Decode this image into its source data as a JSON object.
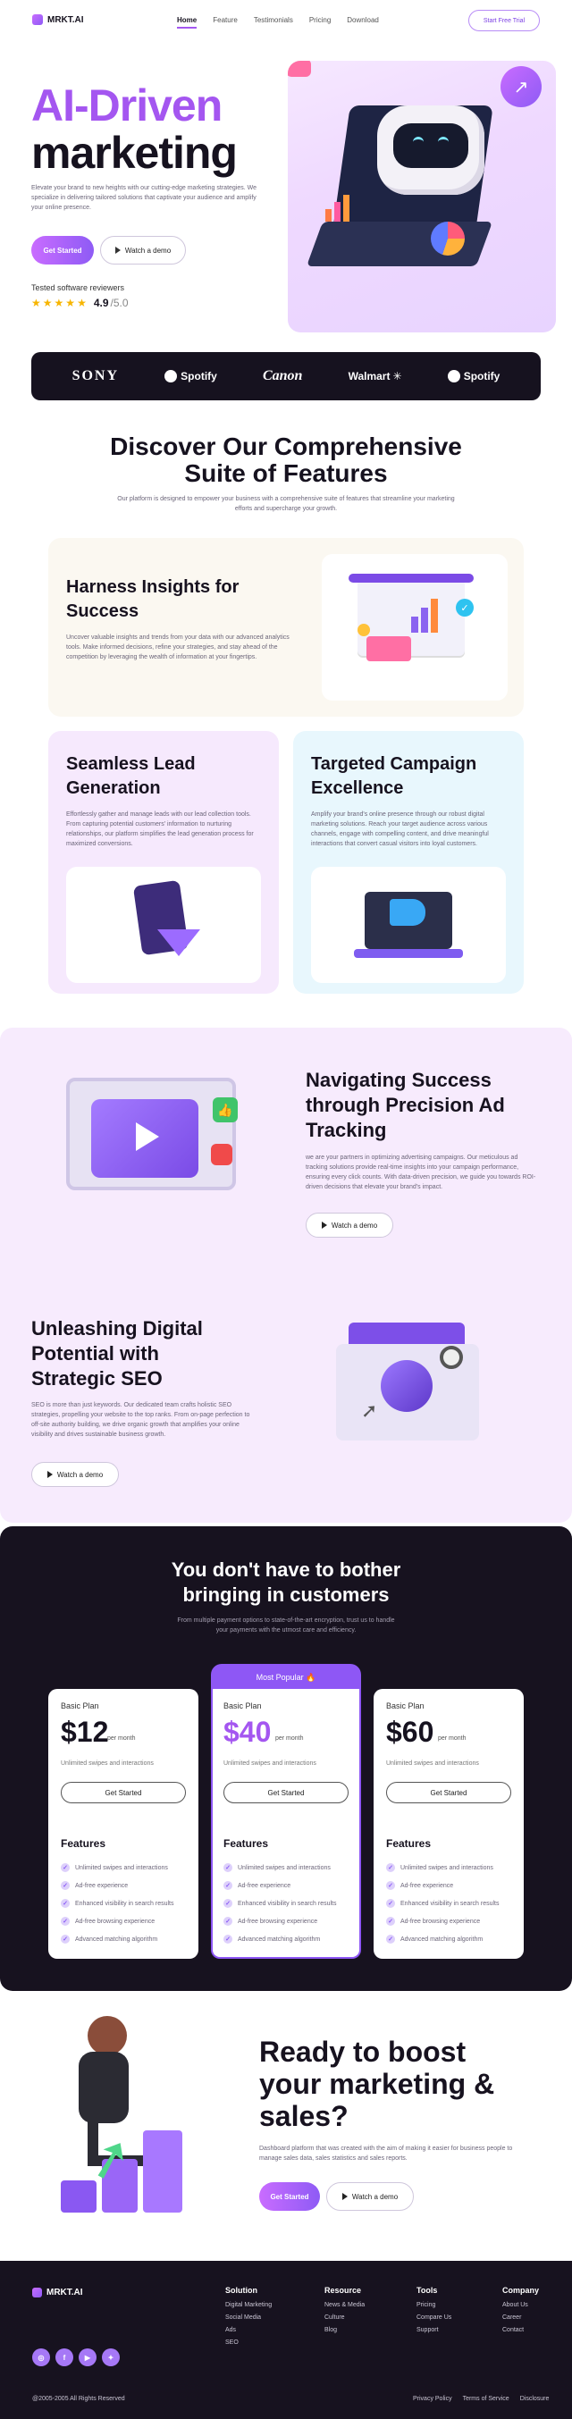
{
  "nav": {
    "logo": "MRKT.AI",
    "links": [
      "Home",
      "Feature",
      "Testimonials",
      "Pricing",
      "Download"
    ],
    "cta": "Start Free Trial"
  },
  "hero": {
    "title_line1": "AI-Driven",
    "title_line2": "marketing",
    "description": "Elevate your brand to new heights with our cutting-edge marketing strategies. We specialize in delivering tailored solutions that captivate your audience and amplify your online presence.",
    "primary_button": "Get Started",
    "secondary_button": "Watch a demo",
    "reviewers_label": "Tested software reviewers",
    "rating": "4.9",
    "rating_max": "/5.0",
    "rating_value": 4.9,
    "rating_out_of": 5
  },
  "brands": [
    "SONY",
    "Spotify",
    "Canon",
    "Walmart",
    "Spotify"
  ],
  "features_section": {
    "title_line1": "Discover Our Comprehensive",
    "title_line2": "Suite of Features",
    "subtitle": "Our platform is designed to empower your business with a comprehensive suite of features that streamline your marketing efforts and supercharge your growth."
  },
  "feature_cards": {
    "insights": {
      "title_line1": "Harness Insights for",
      "title_line2": "Success",
      "body": "Uncover valuable insights and trends from your data with our advanced analytics tools. Make informed decisions, refine your strategies, and stay ahead of the competition by leveraging the wealth of information at your fingertips."
    },
    "lead": {
      "title_line1": "Seamless Lead",
      "title_line2": "Generation",
      "body": "Effortlessly gather and manage leads with our lead collection tools. From capturing potential customers' information to nurturing relationships, our platform simplifies the lead generation process for maximized conversions."
    },
    "campaign": {
      "title_line1": "Targeted Campaign",
      "title_line2": "Excellence",
      "body": "Amplify your brand's online presence through our robust digital marketing solutions. Reach your target audience across various channels, engage with compelling content, and drive meaningful interactions that convert casual visitors into loyal customers."
    }
  },
  "ad_tracking": {
    "title_line1": "Navigating Success",
    "title_line2": "through Precision Ad",
    "title_line3": "Tracking",
    "body": "we are your partners in optimizing advertising campaigns. Our meticulous ad tracking solutions provide real-time insights into your campaign performance, ensuring every click counts. With data-driven precision, we guide you towards ROI-driven decisions that elevate your brand's impact.",
    "button": "Watch a demo"
  },
  "seo": {
    "title_line1": "Unleashing Digital",
    "title_line2": "Potential with",
    "title_line3": "Strategic SEO",
    "body": "SEO is more than just keywords. Our dedicated team crafts holistic SEO strategies, propelling your website to the top ranks. From on-page perfection to off-site authority building, we drive organic growth that amplifies your online visibility and drives sustainable business growth.",
    "button": "Watch a demo"
  },
  "pricing": {
    "title_line1": "You don't have to bother",
    "title_line2": "bringing in customers",
    "subtitle": "From multiple payment options to state-of-the-art encryption, trust us to handle your payments with the utmost care and efficiency.",
    "popular_badge": "Most Popular 🔥",
    "plans": [
      {
        "name": "Basic Plan",
        "price": "$12",
        "period": "per month",
        "desc": "Unlimited swipes and interactions",
        "button": "Get Started"
      },
      {
        "name": "Basic Plan",
        "price": "$40",
        "period": "per month",
        "desc": "Unlimited swipes and interactions",
        "button": "Get Started"
      },
      {
        "name": "Basic Plan",
        "price": "$60",
        "period": "per month",
        "desc": "Unlimited swipes and interactions",
        "button": "Get Started"
      }
    ],
    "features_title": "Features",
    "features": [
      "Unlimited swipes and interactions",
      "Ad-free experience",
      "Enhanced visibility in search results",
      "Ad-free browsing experience",
      "Advanced matching algorithm"
    ]
  },
  "cta": {
    "title_line1": "Ready to boost",
    "title_line2": "your marketing &",
    "title_line3": "sales?",
    "body": "Dashboard platform that was created with the aim of making it easier for business people to manage sales data, sales statistics and sales reports.",
    "primary_button": "Get Started",
    "secondary_button": "Watch a demo"
  },
  "footer": {
    "logo": "MRKT.AI",
    "columns": [
      {
        "title": "Solution",
        "links": [
          "Digital Marketing",
          "Social Media",
          "Ads",
          "SEO"
        ]
      },
      {
        "title": "Resource",
        "links": [
          "News & Media",
          "Culture",
          "Blog"
        ]
      },
      {
        "title": "Tools",
        "links": [
          "Pricing",
          "Compare Us",
          "Support"
        ]
      },
      {
        "title": "Company",
        "links": [
          "About Us",
          "Career",
          "Contact"
        ]
      }
    ],
    "copyright": "@2005-2005 All Rights Reserved",
    "legal": [
      "Privacy Policy",
      "Terms of Service",
      "Disclosure"
    ],
    "social_icons": [
      "instagram-icon",
      "facebook-icon",
      "youtube-icon",
      "twitter-icon"
    ]
  },
  "colors": {
    "accent": "#a456f0",
    "dark": "#17121f",
    "lavender": "#f7ebfd"
  }
}
